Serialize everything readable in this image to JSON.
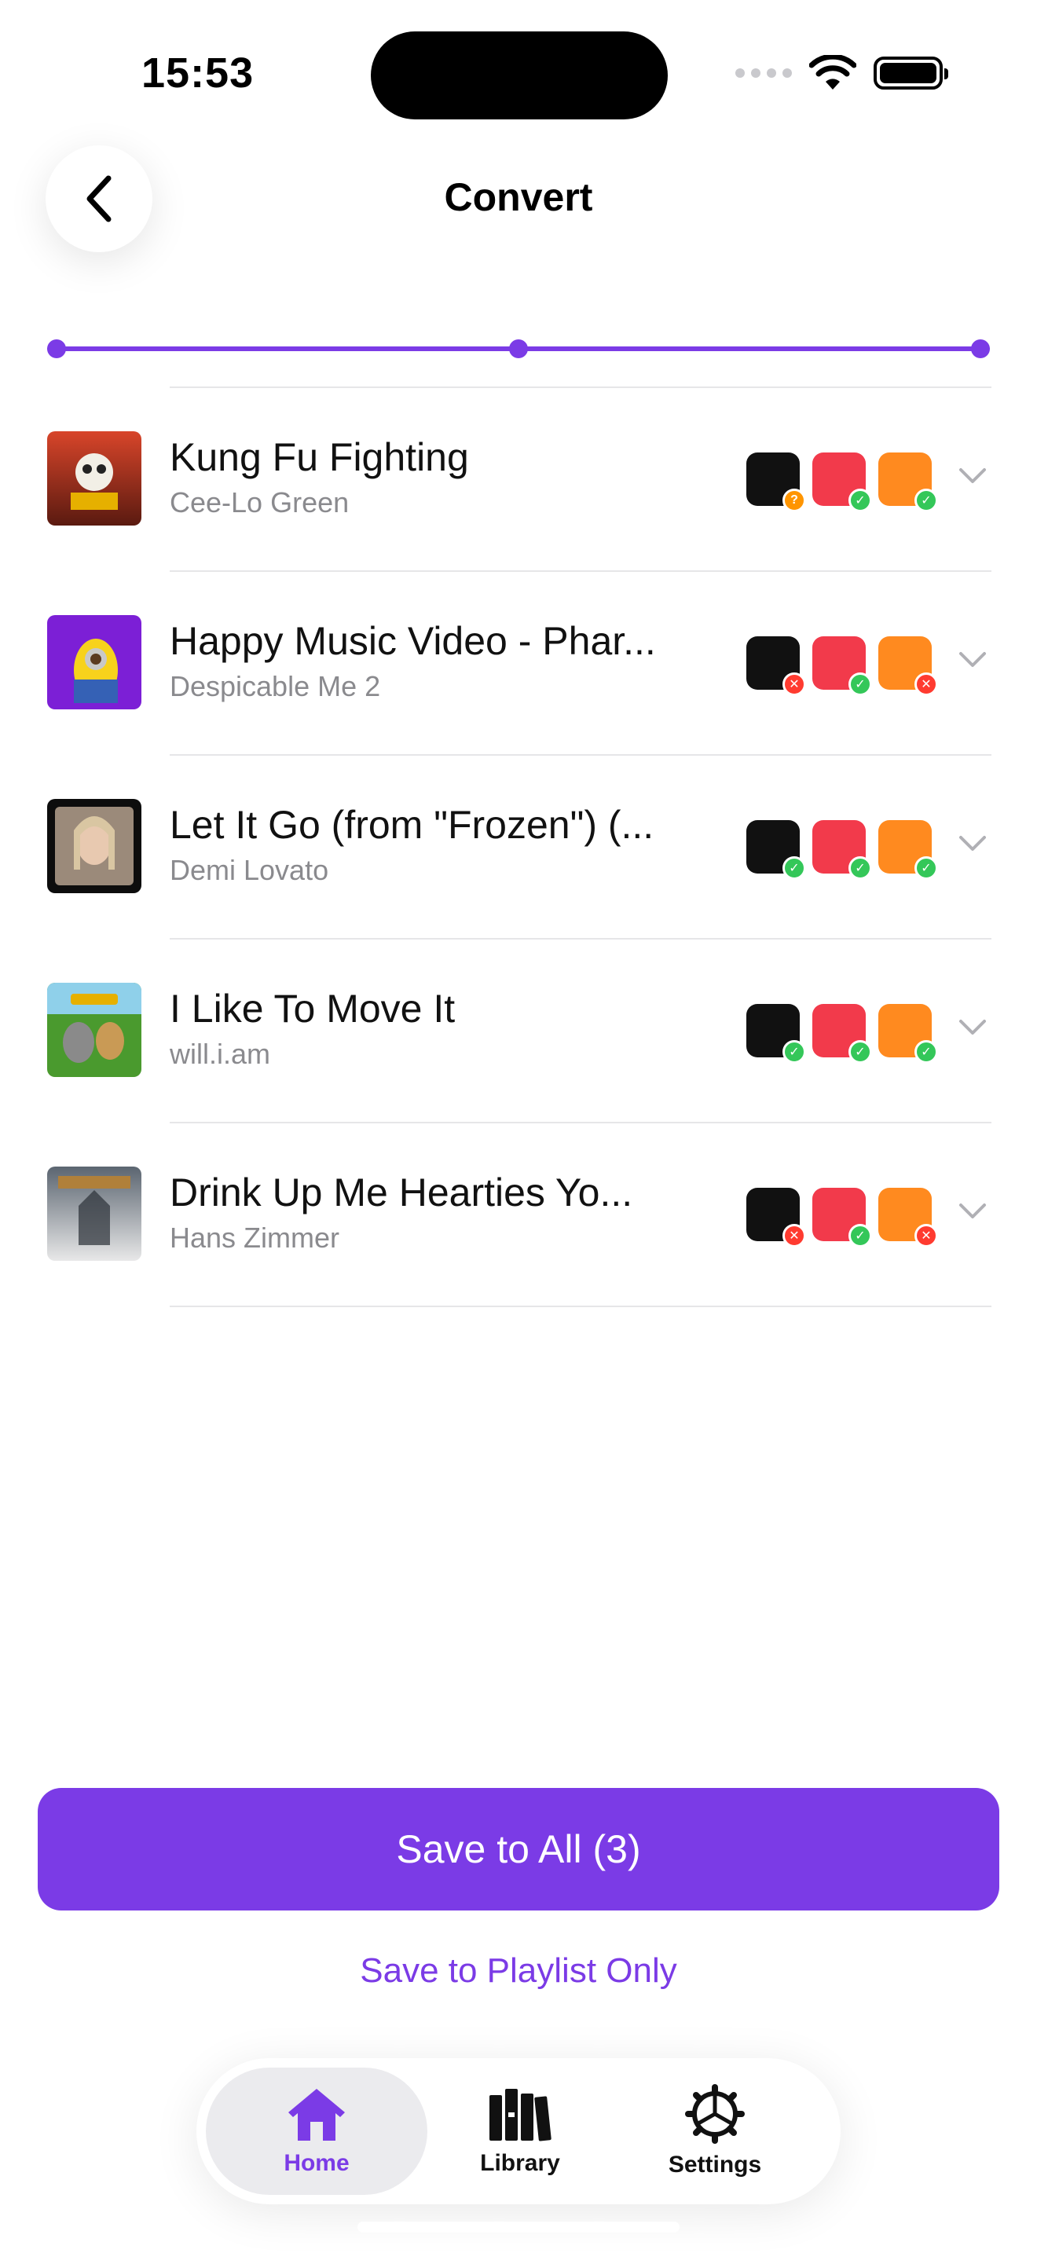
{
  "colors": {
    "accent": "#7b3be6",
    "text_primary": "#111111",
    "text_secondary": "#8a8a8e",
    "success": "#34c759",
    "error": "#ff3b30",
    "unknown": "#ff9500"
  },
  "status_bar": {
    "time": "15:53",
    "icons": [
      "signal-dots-icon",
      "wifi-icon",
      "battery-icon"
    ]
  },
  "header": {
    "title": "Convert",
    "back_icon": "chevron-left-icon"
  },
  "progress": {
    "steps_total": 3,
    "steps_completed": 3
  },
  "services": [
    "service-a",
    "apple-music",
    "service-c"
  ],
  "tracks": [
    {
      "title": "Kung Fu Fighting",
      "artist": "Cee-Lo Green",
      "status": [
        "unknown",
        "ok",
        "ok"
      ]
    },
    {
      "title": "Happy Music Video - Phar...",
      "artist": "Despicable Me 2",
      "status": [
        "no",
        "ok",
        "no"
      ]
    },
    {
      "title": "Let It Go (from \"Frozen\") (...",
      "artist": "Demi Lovato",
      "status": [
        "ok",
        "ok",
        "ok"
      ]
    },
    {
      "title": "I Like To Move It",
      "artist": "will.i.am",
      "status": [
        "ok",
        "ok",
        "ok"
      ]
    },
    {
      "title": "Drink Up Me Hearties Yo...",
      "artist": "Hans Zimmer",
      "status": [
        "no",
        "ok",
        "no"
      ]
    }
  ],
  "actions": {
    "primary": "Save to All (3)",
    "secondary": "Save to Playlist Only"
  },
  "tabbar": {
    "items": [
      {
        "label": "Home",
        "icon": "home-icon",
        "active": true
      },
      {
        "label": "Library",
        "icon": "library-icon",
        "active": false
      },
      {
        "label": "Settings",
        "icon": "settings-icon",
        "active": false
      }
    ]
  }
}
